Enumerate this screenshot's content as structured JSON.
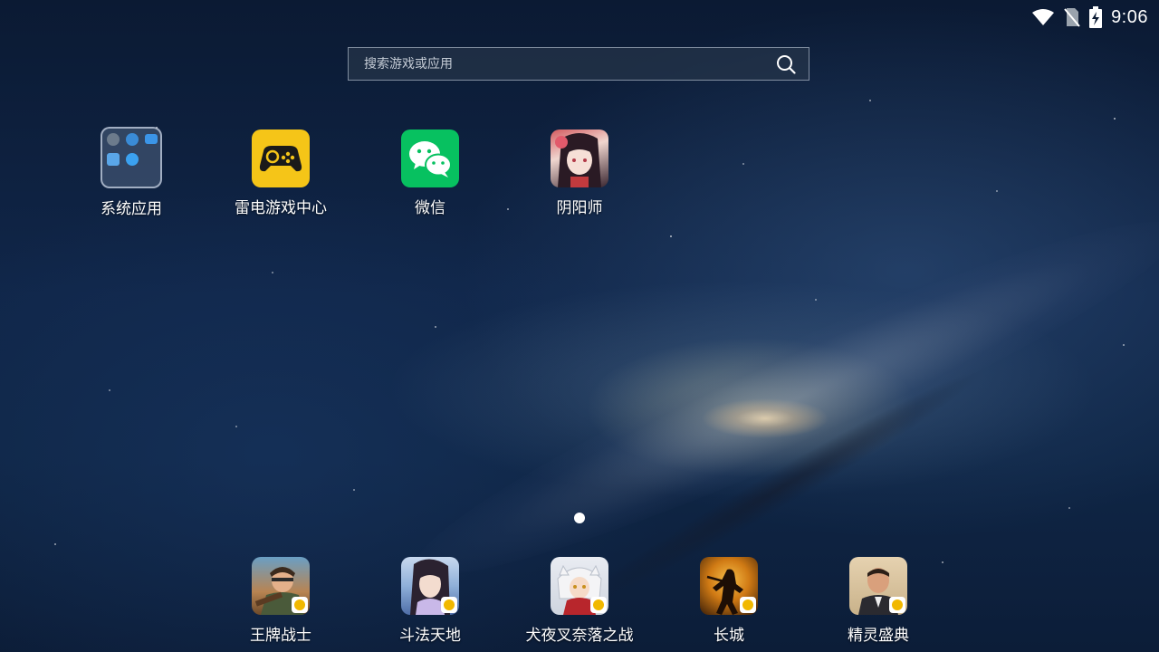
{
  "status_bar": {
    "time": "9:06",
    "icons": [
      "wifi-icon",
      "no-sim-icon",
      "battery-charging-icon"
    ]
  },
  "search": {
    "placeholder": "搜索游戏或应用",
    "icon": "search-icon"
  },
  "desktop_apps": [
    {
      "label": "系统应用",
      "icon": "folder-icon"
    },
    {
      "label": "雷电游戏中心",
      "icon": "gamepad-icon"
    },
    {
      "label": "微信",
      "icon": "wechat-icon"
    },
    {
      "label": "阴阳师",
      "icon": "onmyoji-icon"
    }
  ],
  "page_indicator": {
    "current": 1,
    "total": 1
  },
  "dock_apps": [
    {
      "label": "王牌战士",
      "icon": "ace-warrior-icon"
    },
    {
      "label": "斗法天地",
      "icon": "doufa-tiandi-icon"
    },
    {
      "label": "犬夜叉奈落之战",
      "icon": "inuyasha-icon"
    },
    {
      "label": "长城",
      "icon": "great-wall-icon"
    },
    {
      "label": "精灵盛典",
      "icon": "elf-festival-icon"
    }
  ],
  "colors": {
    "accent_yellow": "#f5c518",
    "wechat_green": "#07c160"
  }
}
